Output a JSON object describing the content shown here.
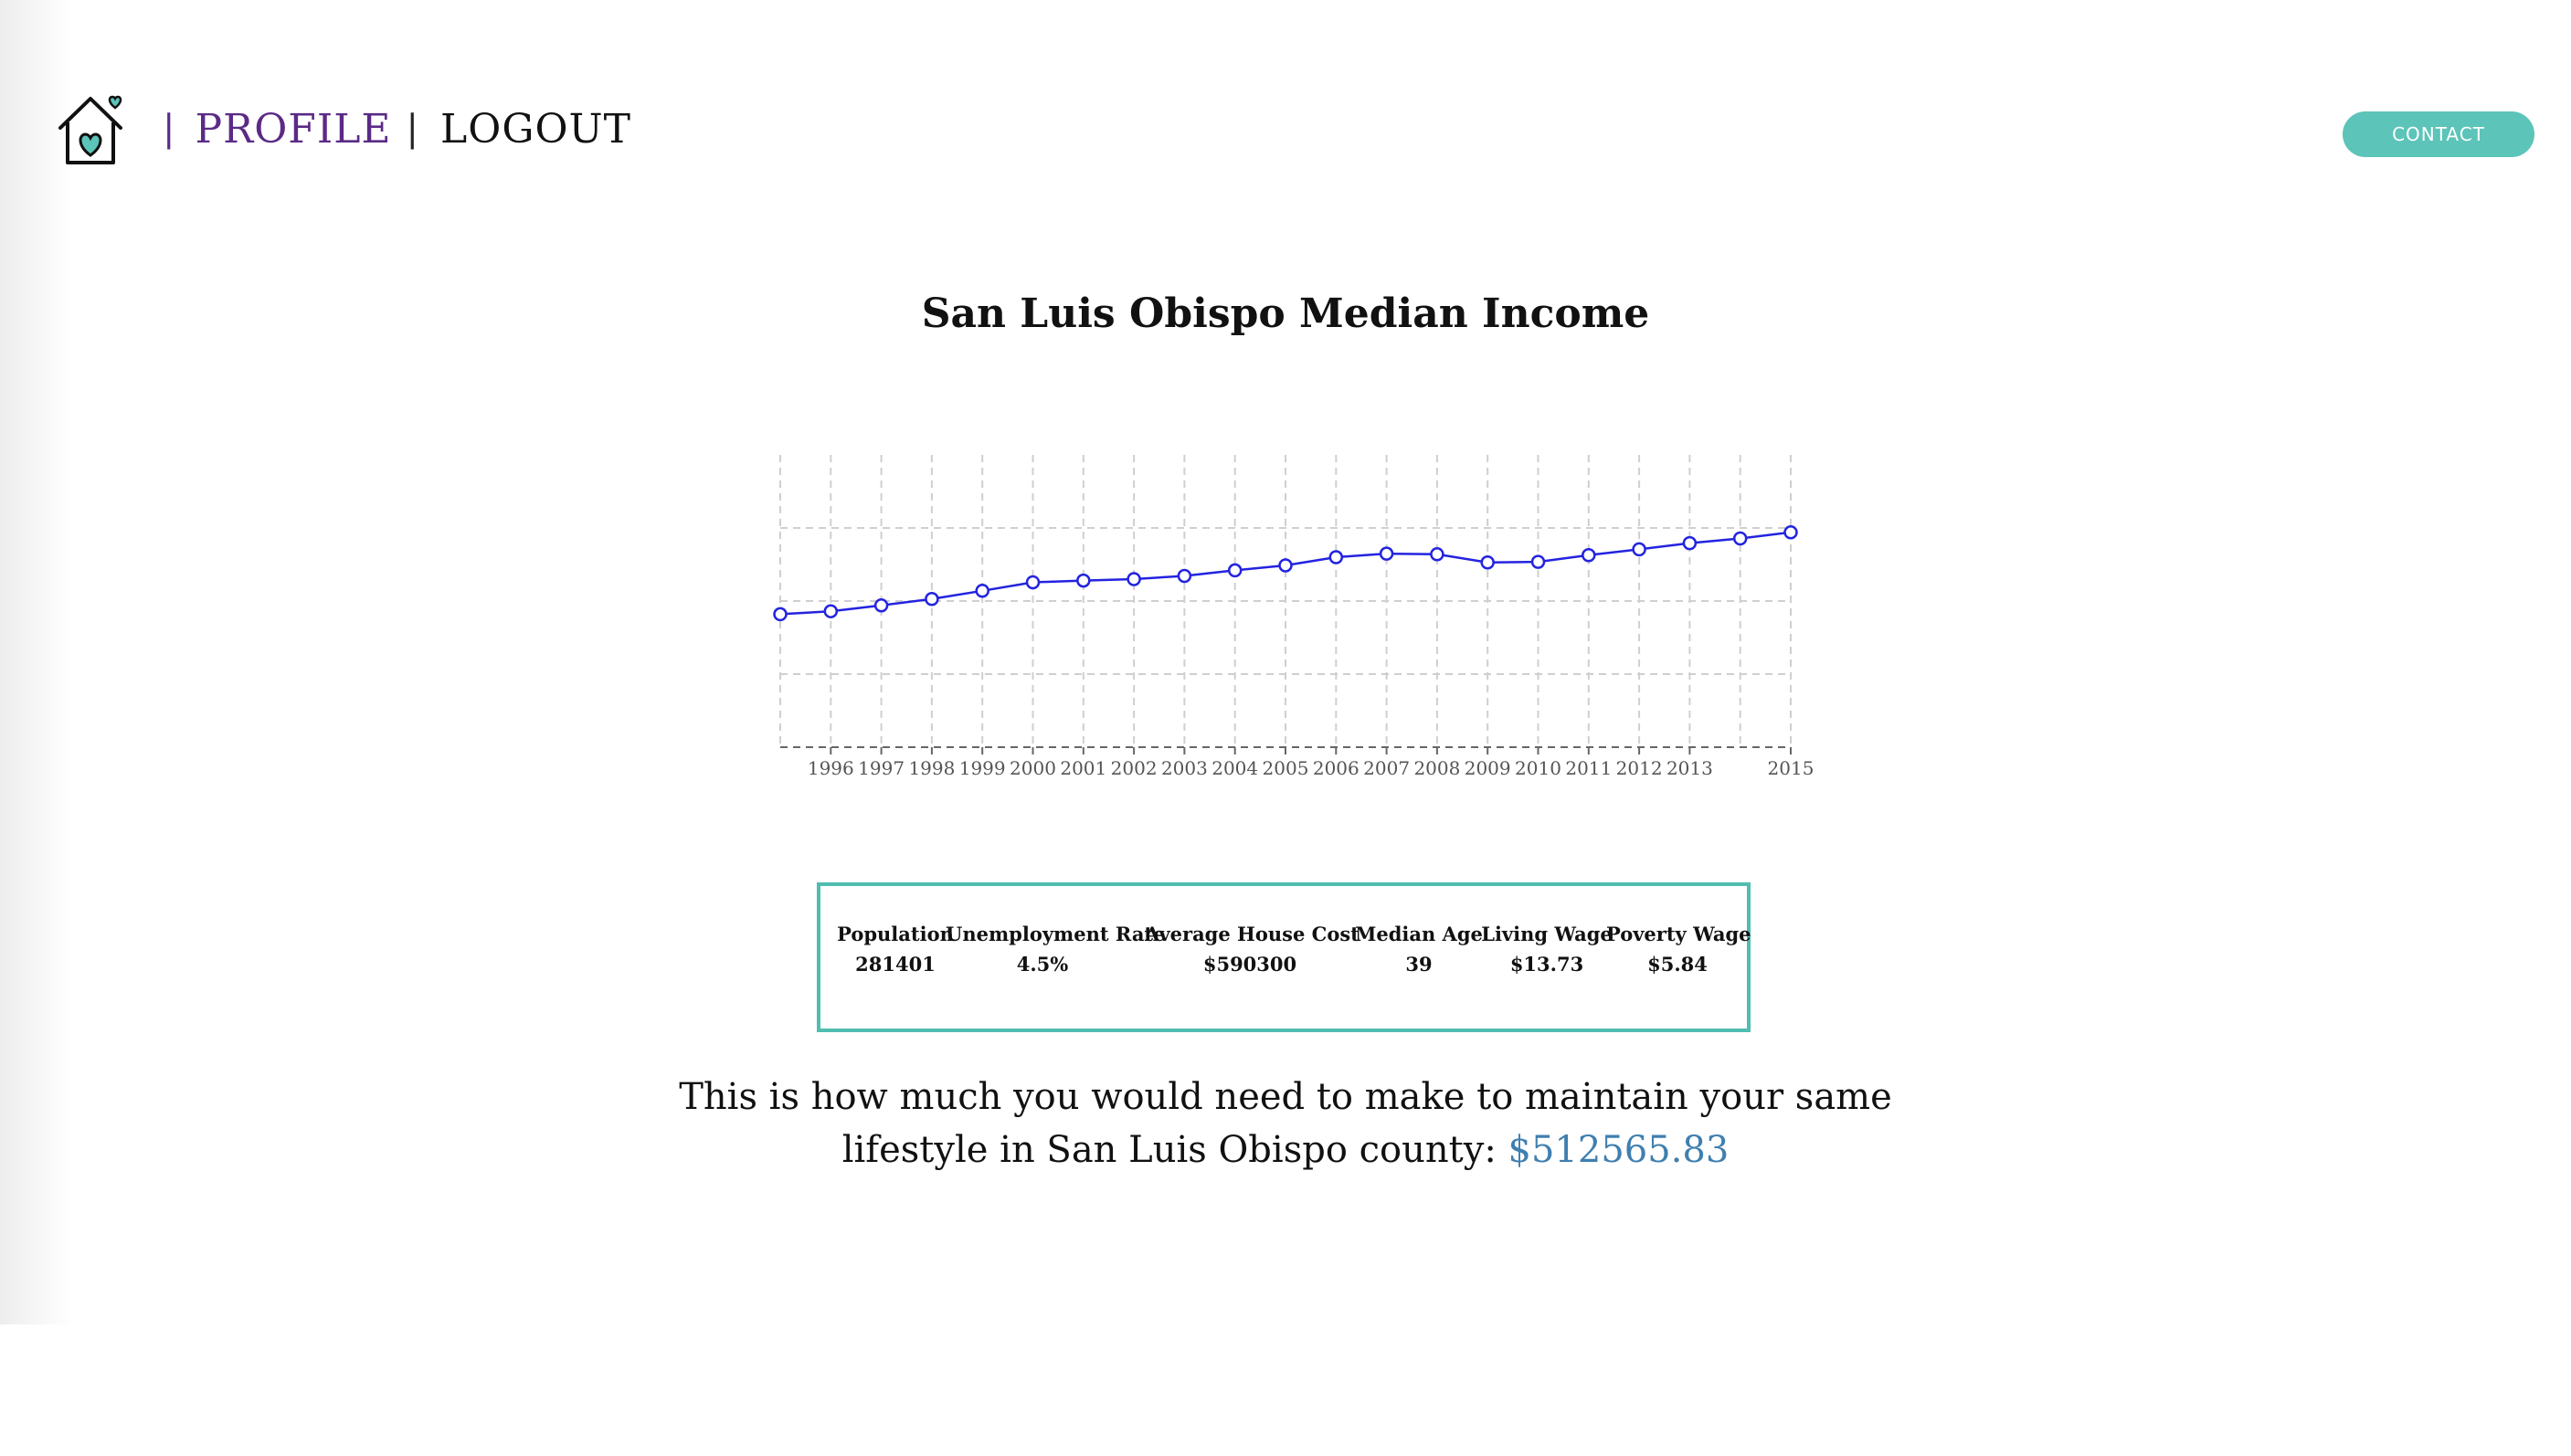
{
  "nav": {
    "profile_label": "PROFILE",
    "logout_label": "LOGOUT",
    "separator": "|",
    "contact_label": "CONTACT",
    "logo_icon": "house-heart-icon"
  },
  "colors": {
    "accent_teal": "#5cc4b8",
    "profile_purple": "#5b2a86",
    "line_blue": "#2323e0",
    "amount_blue": "#3f7fb0"
  },
  "chart_data": {
    "type": "line",
    "title": "San Luis Obispo Median Income",
    "xlabel": "",
    "ylabel": "",
    "x_tick_labels": [
      "1996",
      "1997",
      "1998",
      "1999",
      "2000",
      "2001",
      "2002",
      "2003",
      "2004",
      "2005",
      "2006",
      "2007",
      "2008",
      "2009",
      "2010",
      "2011",
      "2012",
      "2013",
      "2015"
    ],
    "x": [
      1995,
      1996,
      1997,
      1998,
      1999,
      2000,
      2001,
      2002,
      2003,
      2004,
      2005,
      2006,
      2007,
      2008,
      2009,
      2010,
      2011,
      2012,
      2013,
      2014,
      2015
    ],
    "series": [
      {
        "name": "",
        "values": [
          45500,
          46500,
          48500,
          50700,
          53500,
          56400,
          57000,
          57500,
          58600,
          60500,
          62200,
          65000,
          66200,
          66000,
          63200,
          63400,
          65700,
          67700,
          69800,
          71400,
          73500
        ]
      }
    ],
    "ylim": [
      0,
      100000
    ],
    "grid": true,
    "legend": "none"
  },
  "stats": [
    {
      "label": "Population",
      "value": "281401"
    },
    {
      "label": "Unemployment Rate",
      "value": "4.5%"
    },
    {
      "label": "Average House Cost",
      "value": "$590300"
    },
    {
      "label": "Median Age",
      "value": "39"
    },
    {
      "label": "Living Wage",
      "value": "$13.73"
    },
    {
      "label": "Poverty Wage",
      "value": "$5.84"
    }
  ],
  "message": {
    "line1": "This is how much you would need to make to maintain your same",
    "line2": "lifestyle in San Luis Obispo county:",
    "amount": "$512565.83"
  }
}
